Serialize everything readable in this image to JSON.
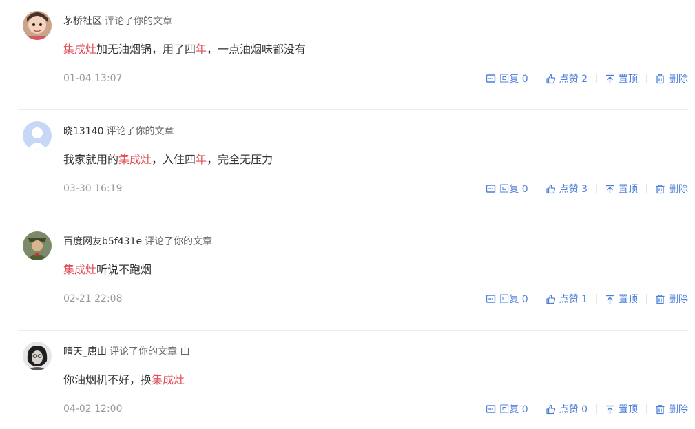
{
  "colors": {
    "accent": "#4e7fd8",
    "highlight": "#e0515a",
    "muted": "#999999"
  },
  "comments": [
    {
      "user": "茅桥社区",
      "action": "评论了你的文章",
      "content": [
        {
          "t": "集成灶",
          "hl": true
        },
        {
          "t": "加无油烟锅，用了四",
          "hl": false
        },
        {
          "t": "年",
          "hl": true
        },
        {
          "t": "，一点油烟味都没有",
          "hl": false
        }
      ],
      "time": "01-04 13:07",
      "reply_label": "回复 0",
      "like_label": "点赞 2",
      "pin_label": "置顶",
      "delete_label": "删除"
    },
    {
      "user": "晓13140",
      "action": "评论了你的文章",
      "content": [
        {
          "t": "我家就用的",
          "hl": false
        },
        {
          "t": "集成灶",
          "hl": true
        },
        {
          "t": "，入住四",
          "hl": false
        },
        {
          "t": "年",
          "hl": true
        },
        {
          "t": "，完全无压力",
          "hl": false
        }
      ],
      "time": "03-30 16:19",
      "reply_label": "回复 0",
      "like_label": "点赞 3",
      "pin_label": "置顶",
      "delete_label": "删除"
    },
    {
      "user": "百度网友b5f431e",
      "action": "评论了你的文章",
      "content": [
        {
          "t": "集成灶",
          "hl": true
        },
        {
          "t": "听说不跑烟",
          "hl": false
        }
      ],
      "time": "02-21 22:08",
      "reply_label": "回复 0",
      "like_label": "点赞 1",
      "pin_label": "置顶",
      "delete_label": "删除"
    },
    {
      "user": "晴天_唐山",
      "action": "评论了你的文章 山",
      "content": [
        {
          "t": "你油烟机不好，换",
          "hl": false
        },
        {
          "t": "集成灶",
          "hl": true
        }
      ],
      "time": "04-02 12:00",
      "reply_label": "回复 0",
      "like_label": "点赞 0",
      "pin_label": "置顶",
      "delete_label": "删除"
    }
  ]
}
